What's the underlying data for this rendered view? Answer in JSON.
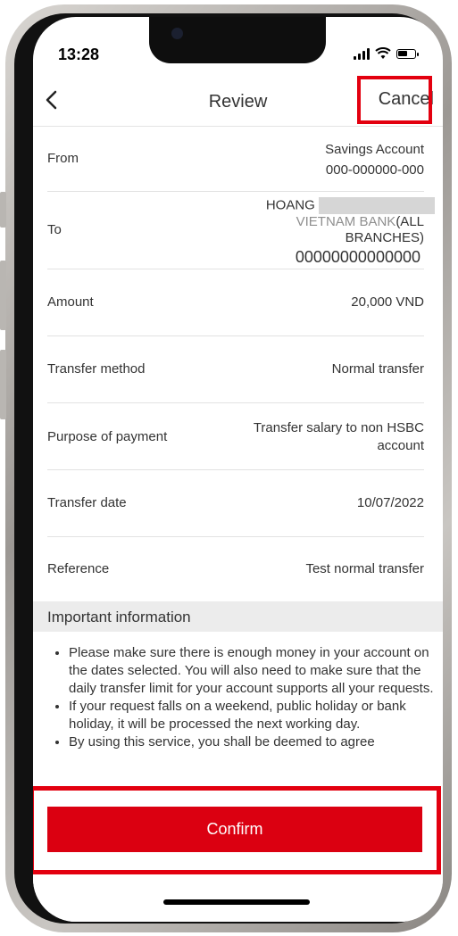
{
  "status": {
    "time": "13:28"
  },
  "header": {
    "title": "Review",
    "cancel_label": "Cancel"
  },
  "rows": {
    "from": {
      "label": "From",
      "account_name": "Savings Account",
      "account_number": "000-000000-000"
    },
    "to": {
      "label": "To",
      "name": "HOANG",
      "bank_a": "VIETNAM BANK",
      "bank_b": "(ALL",
      "bank_c": "BRANCHES)",
      "account_number": "00000000000000"
    },
    "amount": {
      "label": "Amount",
      "value": "20,000 VND"
    },
    "method": {
      "label": "Transfer method",
      "value": "Normal transfer"
    },
    "purpose": {
      "label": "Purpose of payment",
      "value_line1": "Transfer salary to non HSBC",
      "value_line2": "account"
    },
    "date": {
      "label": "Transfer date",
      "value": "10/07/2022"
    },
    "reference": {
      "label": "Reference",
      "value": "Test normal transfer"
    }
  },
  "important": {
    "heading": "Important information",
    "items": [
      "Please make sure there is enough money in your account on the dates selected. You will also need to make sure that the daily transfer limit for your account supports all your requests.",
      "If your request falls on a weekend, public holiday or bank holiday, it will be processed the next working day.",
      "By using this service, you shall be deemed to agree"
    ]
  },
  "footer": {
    "confirm_label": "Confirm"
  },
  "colors": {
    "brand_red": "#db0011",
    "highlight_red": "#e3000f"
  }
}
